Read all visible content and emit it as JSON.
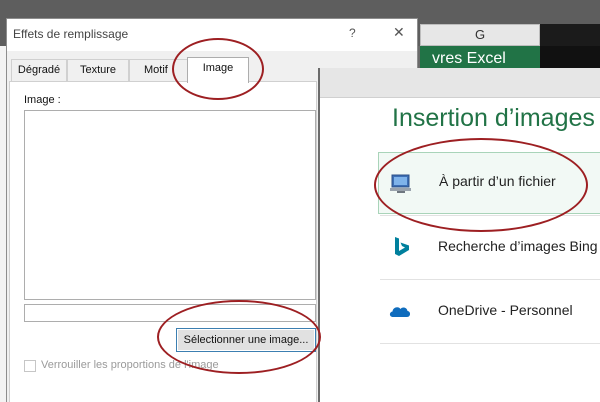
{
  "background": {
    "column_g": "G",
    "ribbon_text": "vres Excel"
  },
  "dialog": {
    "title": "Effets de remplissage",
    "help_glyph": "?",
    "close_glyph": "✕",
    "tabs": [
      "Dégradé",
      "Texture",
      "Motif",
      "Image"
    ],
    "active_tab": "Image",
    "image_label": "Image :",
    "select_button": "Sélectionner une image...",
    "lock_label": "Verrouiller les proportions de l'image"
  },
  "insert_panel": {
    "title": "Insertion d’images",
    "options": [
      {
        "label": "À partir d’un fichier",
        "icon": "computer-icon"
      },
      {
        "label": "Recherche d’images Bing",
        "icon": "bing-icon"
      },
      {
        "label": "OneDrive - Personnel",
        "icon": "onedrive-icon"
      }
    ]
  },
  "colors": {
    "accent_green": "#217346",
    "annotation_red": "#9d1f22"
  }
}
